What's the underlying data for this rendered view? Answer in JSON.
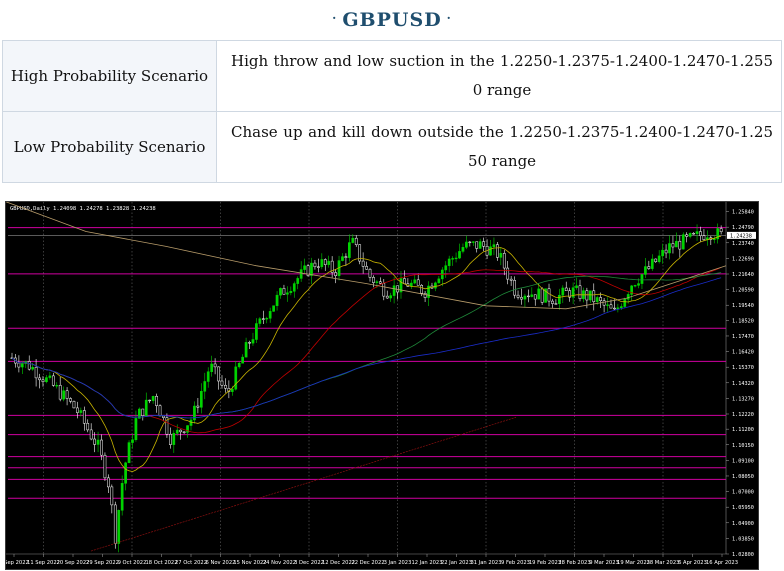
{
  "header": {
    "title": "GBPUSD",
    "dot_left": "·",
    "dot_right": "·"
  },
  "scenarios": [
    {
      "label": "High Probability Scenario",
      "text": "High throw and low suction in the 1.2250-1.2375-1.2400-1.2470-1.2550 range"
    },
    {
      "label": "Low Probability Scenario",
      "text": "Chase up and kill down outside the 1.2250-1.2375-1.2400-1.2470-1.2550 range"
    }
  ],
  "chart_data": {
    "type": "candlestick",
    "symbol_caption": "GBPUSD,Daily  1.24098 1.24278 1.23828 1.24238",
    "price_labels": [
      "1.25840",
      "1.24790",
      "1.23740",
      "1.22690",
      "1.21640",
      "1.20590",
      "1.19540",
      "1.18520",
      "1.17470",
      "1.16420",
      "1.15370",
      "1.14320",
      "1.13270",
      "1.12220",
      "1.11200",
      "1.10150",
      "1.09100",
      "1.08050",
      "1.07000",
      "1.05950",
      "1.04900",
      "1.03850",
      "1.02800"
    ],
    "current_price": "1.24238",
    "date_labels": [
      "1 Sep 2022",
      "11 Sep 2022",
      "20 Sep 2022",
      "29 Sep 2022",
      "9 Oct 2022",
      "18 Oct 2022",
      "27 Oct 2022",
      "6 Nov 2022",
      "15 Nov 2022",
      "24 Nov 2022",
      "3 Dec 2022",
      "12 Dec 2022",
      "22 Dec 2022",
      "3 Jan 2023",
      "12 Jan 2023",
      "22 Jan 2023",
      "31 Jan 2023",
      "9 Feb 2023",
      "19 Feb 2023",
      "28 Feb 2023",
      "9 Mar 2023",
      "19 Mar 2023",
      "28 Mar 2023",
      "6 Apr 2023",
      "16 Apr 2023"
    ],
    "ylim": [
      1.028,
      1.2635
    ],
    "fib_levels": [
      1.2476,
      1.2165,
      1.1799,
      1.1576,
      1.1213,
      1.1083,
      1.0935,
      1.086,
      1.0782,
      1.0655
    ],
    "colors": {
      "up": "#00d400",
      "down": "#ffffff",
      "fib": "#d000a0",
      "ma_fast": "#c8b400",
      "ma_mid": "#c00000",
      "ma_slow": "#1a2cc8",
      "ma_long": "#1f8a3a",
      "ma_tan": "#b89c6a"
    }
  }
}
